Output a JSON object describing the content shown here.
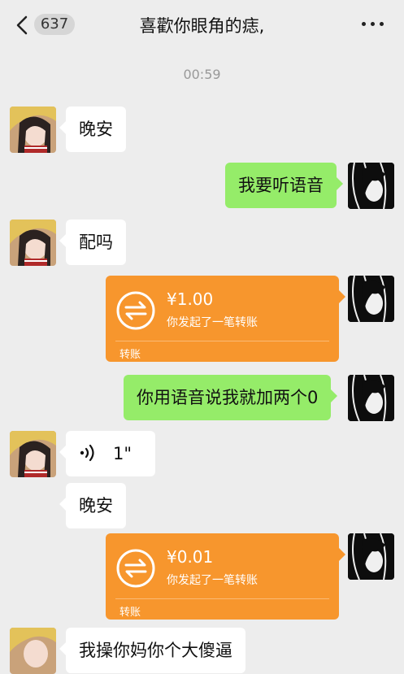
{
  "header": {
    "unread_count": "637",
    "title": "喜歡你眼角的痣,"
  },
  "time_divider": "00:59",
  "messages": [
    {
      "side": "in",
      "type": "text",
      "text": "晚安"
    },
    {
      "side": "out",
      "type": "text",
      "text": "我要听语音"
    },
    {
      "side": "in",
      "type": "text",
      "text": "配吗"
    },
    {
      "side": "out",
      "type": "transfer",
      "amount": "¥1.00",
      "desc": "你发起了一笔转账",
      "label": "转账"
    },
    {
      "side": "out",
      "type": "text",
      "text": "你用语音说我就加两个0"
    },
    {
      "side": "in",
      "type": "voice",
      "duration": "1\""
    },
    {
      "side": "in",
      "type": "text",
      "text": "晚安"
    },
    {
      "side": "out",
      "type": "transfer",
      "amount": "¥0.01",
      "desc": "你发起了一笔转账",
      "label": "转账"
    },
    {
      "side": "in",
      "type": "text",
      "text": "我操你妈你个大傻逼"
    }
  ],
  "colors": {
    "background": "#ededed",
    "outgoing_bubble": "#95ec69",
    "incoming_bubble": "#ffffff",
    "transfer_card": "#f7962d"
  }
}
